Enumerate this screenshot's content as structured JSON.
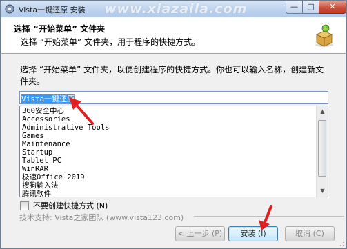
{
  "window": {
    "title": "Vista一键还原 安装",
    "watermark": "www.xiazaila.com",
    "minimize_glyph": "—",
    "maximize_glyph": "□",
    "close_glyph": "✕"
  },
  "header": {
    "title": "选择 “开始菜单” 文件夹",
    "subtitle": "选择 “开始菜单” 文件夹，用于程序的快捷方式。",
    "icon": "installer-box-icon"
  },
  "body": {
    "description": "选择 “开始菜单” 文件夹，以便创建程序的快捷方式。你也可以输入名称，创建新文件夹。",
    "folder_input_value": "Vista一键还原",
    "folder_list": [
      "360安全中心",
      "Accessories",
      "Administrative Tools",
      "Games",
      "Maintenance",
      "Startup",
      "Tablet PC",
      "WinRAR",
      "极速Office 2019",
      "搜狗输入法",
      "腾讯软件"
    ],
    "no_shortcut_label": "不要创建快捷方式 (N)",
    "no_shortcut_checked": false
  },
  "footer": {
    "brand_text": "技术支持: Vista之家团队 (www.vista123.com)",
    "back_label": "< 上一步 (P)",
    "install_label": "安装 (I)",
    "cancel_label": "取消 (C)"
  },
  "colors": {
    "titlebar": "#bcd2ee",
    "selection": "#3399ff",
    "annotation_arrow": "#e02020",
    "close_button": "#c84b35"
  }
}
